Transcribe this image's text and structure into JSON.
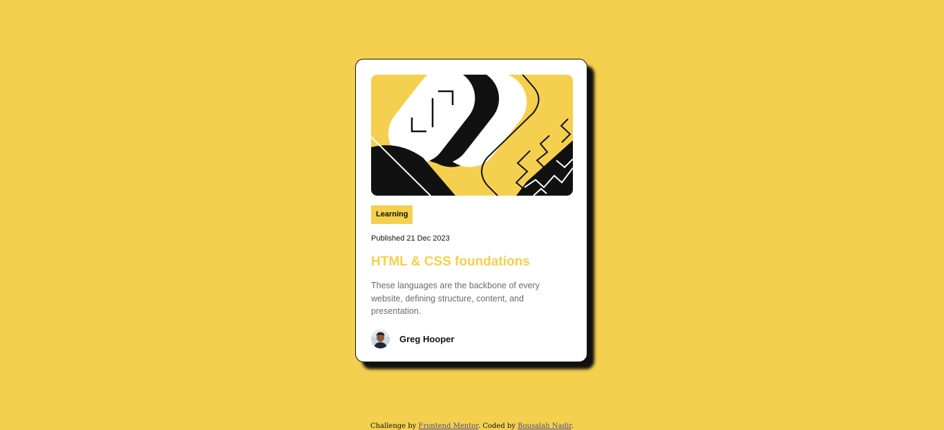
{
  "card": {
    "tag": "Learning",
    "published": "Published 21 Dec 2023",
    "title": "HTML & CSS foundations",
    "description": "These languages are the backbone of every website, defining structure, content, and presentation.",
    "author": "Greg Hooper",
    "hero_image": "illustration-article",
    "avatar_image": "image-avatar"
  },
  "footer": {
    "prefix": "Challenge by ",
    "link1": "Frontend Mentor",
    "middle": ". Coded by ",
    "link2": "Bousalah Nadir",
    "suffix": "."
  },
  "colors": {
    "background": "#f4d04e",
    "card": "#ffffff",
    "ink": "#111111",
    "muted": "#6b6b6b"
  }
}
